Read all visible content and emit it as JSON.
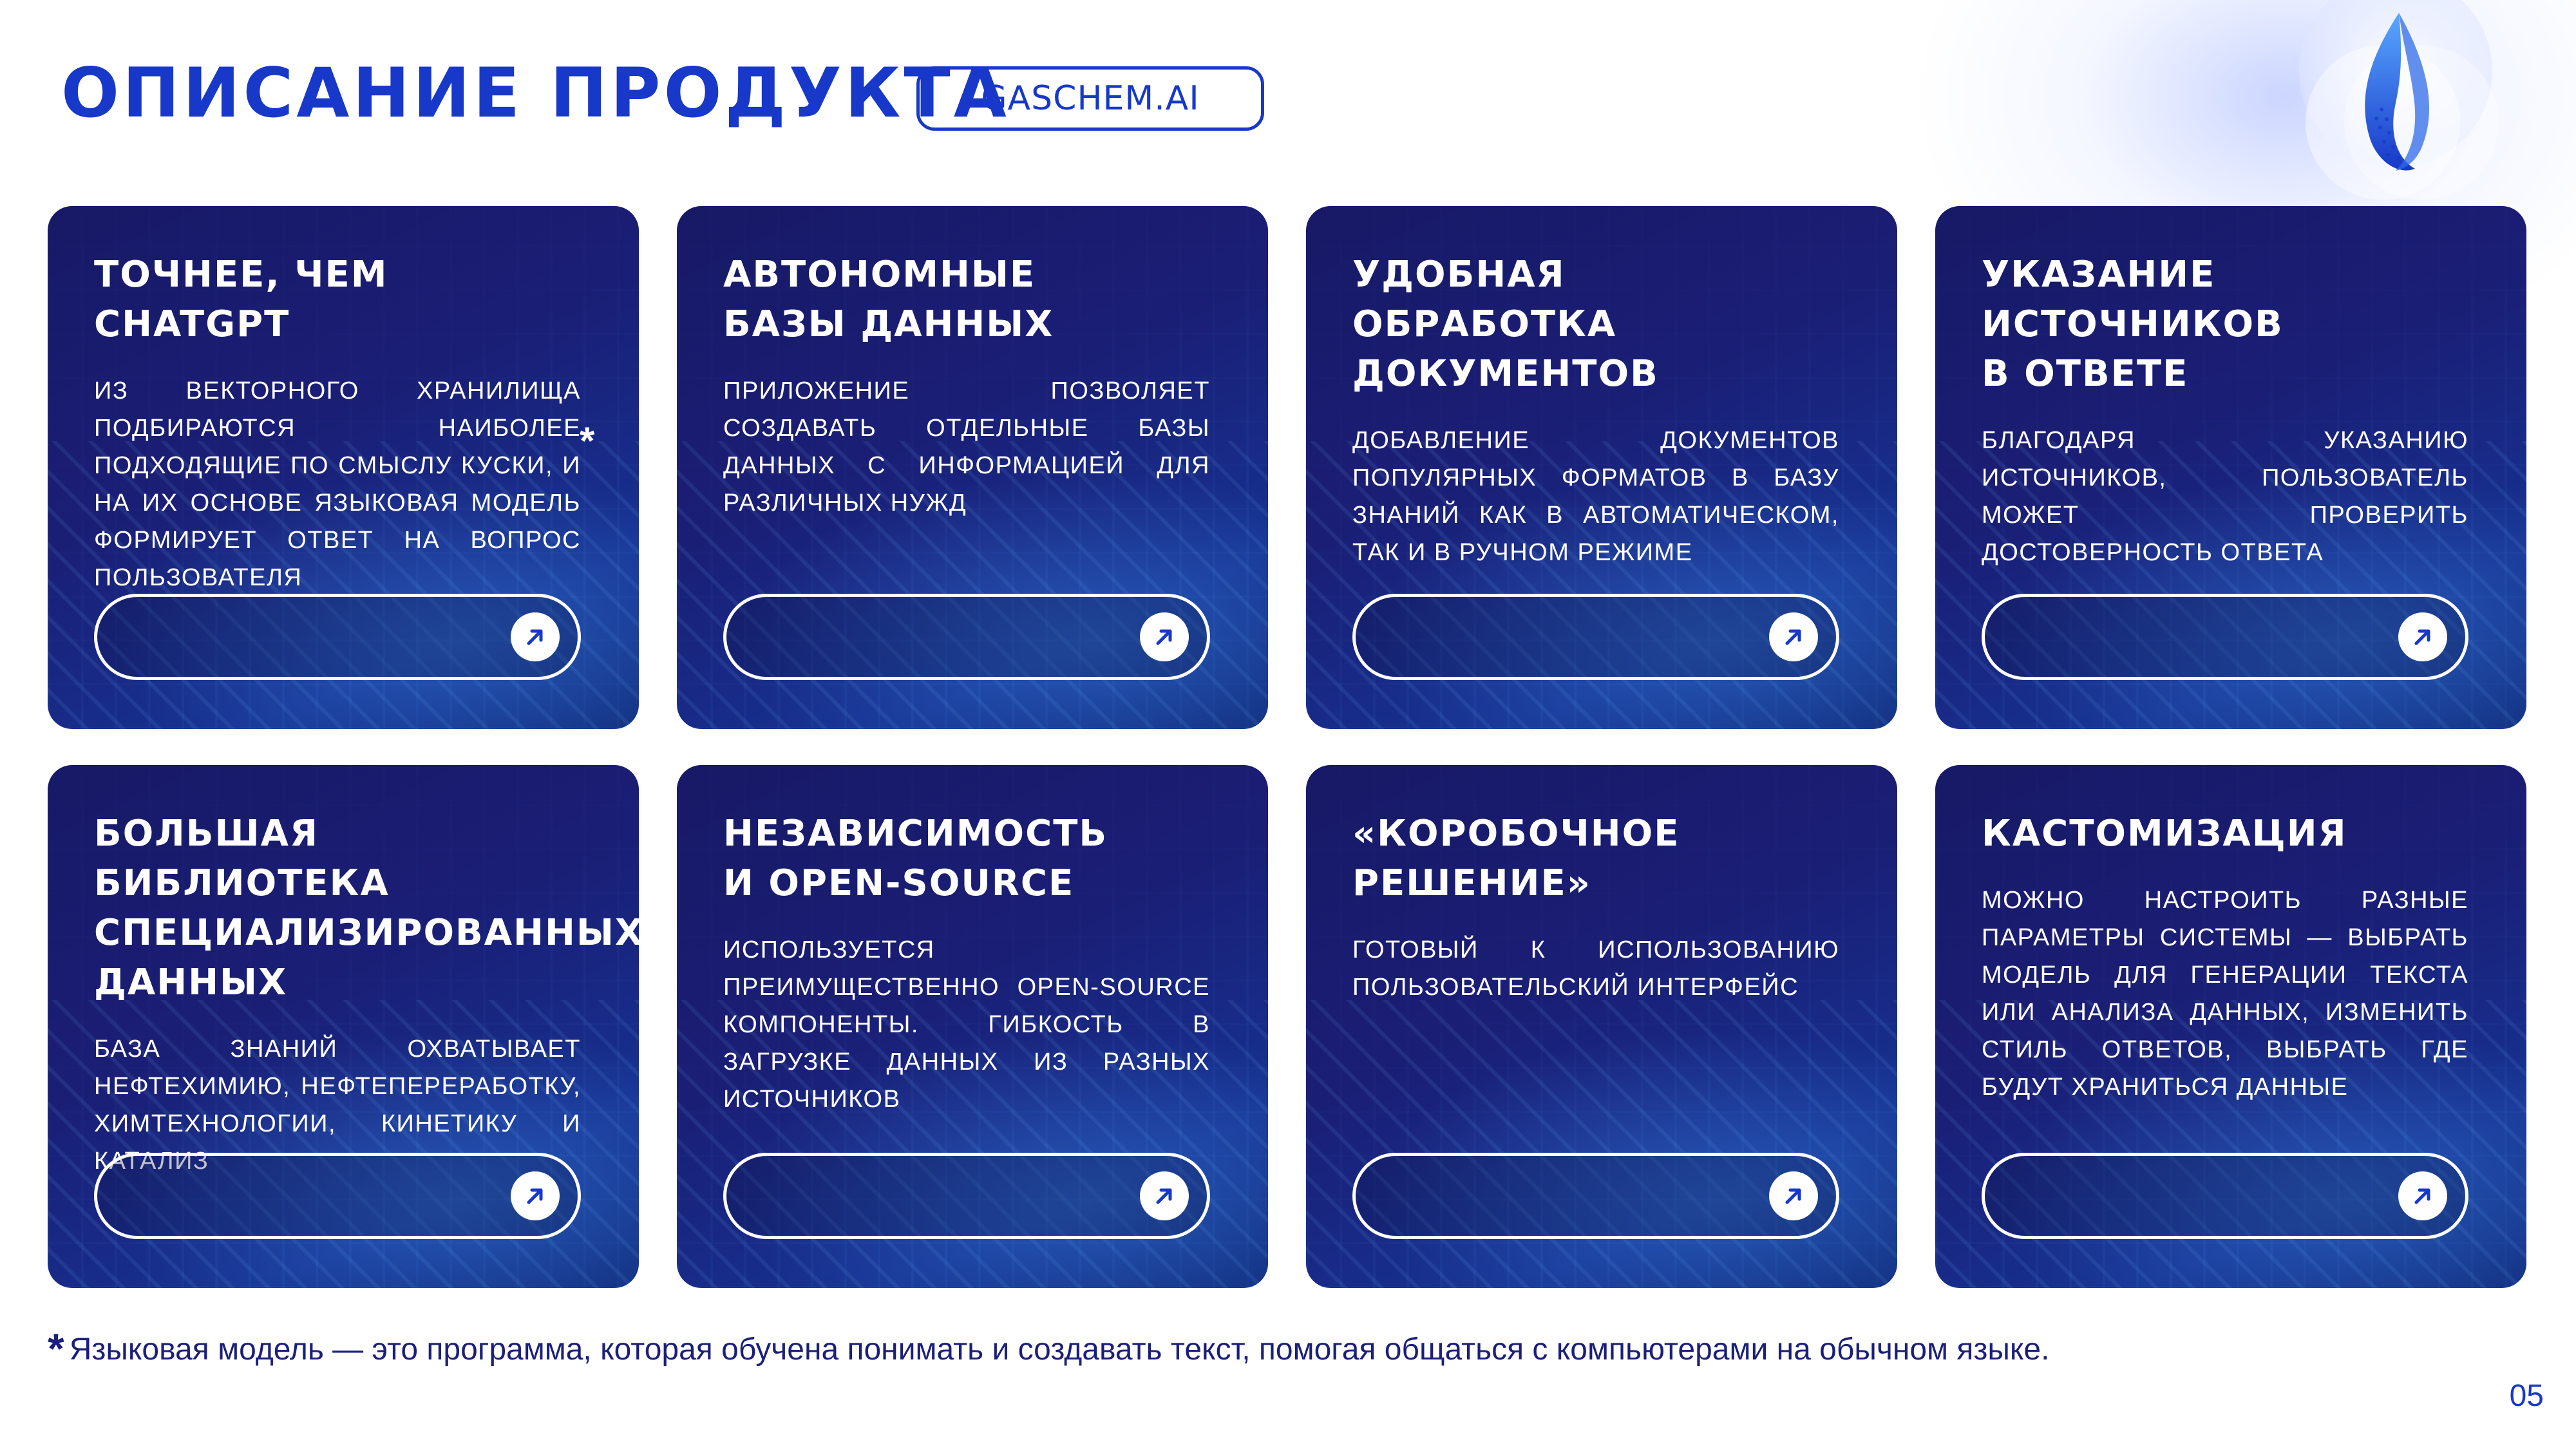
{
  "header": {
    "title": "ОПИСАНИЕ ПРОДУКТА",
    "badge": "GASCHEM.AI"
  },
  "logo": {
    "icon": "flame-drop-icon",
    "accent": "#1738c9"
  },
  "cards": [
    {
      "title": "ТОЧНЕЕ, ЧЕМ CHATGPT",
      "text": "ИЗ ВЕКТОРНОГО ХРАНИЛИЩА ПОДБИРАЮТСЯ НАИБОЛЕЕ ПОДХОДЯЩИЕ ПО СМЫСЛУ КУСКИ, И НА ИХ ОСНОВЕ ЯЗЫКОВАЯ МОДЕЛЬ ФОРМИРУЕТ ОТВЕТ НА ВОПРОС ПОЛЬЗОВАТЕЛЯ",
      "mark": "*"
    },
    {
      "title": "АВТОНОМНЫЕ\nБАЗЫ ДАННЫХ",
      "text": "ПРИЛОЖЕНИЕ ПОЗВОЛЯЕТ СОЗДАВАТЬ ОТДЕЛЬНЫЕ БАЗЫ ДАННЫХ С ИНФОРМАЦИЕЙ ДЛЯ РАЗЛИЧНЫХ НУЖД"
    },
    {
      "title": "УДОБНАЯ\nОБРАБОТКА\nДОКУМЕНТОВ",
      "text": "ДОБАВЛЕНИЕ ДОКУМЕНТОВ ПОПУЛЯРНЫХ ФОРМАТОВ В БАЗУ ЗНАНИЙ КАК В АВТОМАТИЧЕСКОМ, ТАК И В РУЧНОМ РЕЖИМЕ"
    },
    {
      "title": "УКАЗАНИЕ\nИСТОЧНИКОВ\nВ ОТВЕТЕ",
      "text": "БЛАГОДАРЯ УКАЗАНИЮ ИСТОЧНИКОВ, ПОЛЬЗОВАТЕЛЬ МОЖЕТ ПРОВЕРИТЬ ДОСТОВЕРНОСТЬ ОТВЕТА"
    },
    {
      "title": "БОЛЬШАЯ БИБЛИОТЕКА СПЕЦИАЛИЗИРОВАННЫХ ДАННЫХ",
      "text": "БАЗА ЗНАНИЙ ОХВАТЫВАЕТ НЕФТЕХИМИЮ, НЕФТЕПЕРЕРАБОТКУ, ХИМТЕХНОЛОГИИ, КИНЕТИКУ И КАТАЛИЗ"
    },
    {
      "title": "НЕЗАВИСИМОСТЬ\nИ OPEN-SOURCE",
      "text": "ИСПОЛЬЗУЕТСЯ ПРЕИМУЩЕСТВЕННО OPEN-SOURCE КОМПОНЕНТЫ. ГИБКОСТЬ В ЗАГРУЗКЕ ДАННЫХ ИЗ РАЗНЫХ ИСТОЧНИКОВ"
    },
    {
      "title": "«КОРОБОЧНОЕ\nРЕШЕНИЕ»",
      "text": "ГОТОВЫЙ К ИСПОЛЬЗОВАНИЮ ПОЛЬЗОВАТЕЛЬСКИЙ ИНТЕРФЕЙС"
    },
    {
      "title": "КАСТОМИЗАЦИЯ",
      "text": "МОЖНО НАСТРОИТЬ РАЗНЫЕ ПАРАМЕТРЫ СИСТЕМЫ — ВЫБРАТЬ МОДЕЛЬ ДЛЯ ГЕНЕРАЦИИ ТЕКСТА ИЛИ АНАЛИЗА ДАННЫХ, ИЗМЕНИТЬ СТИЛЬ ОТВЕТОВ, ВЫБРАТЬ ГДЕ БУДУТ ХРАНИТЬСЯ ДАННЫЕ"
    }
  ],
  "card_button_icon": "arrow-up-right-icon",
  "footnote": {
    "mark": "*",
    "text": "Языковая модель — это программа, которая обучена понимать и создавать текст, помогая общаться с компьютерами на обычном языке."
  },
  "page_number": "05"
}
